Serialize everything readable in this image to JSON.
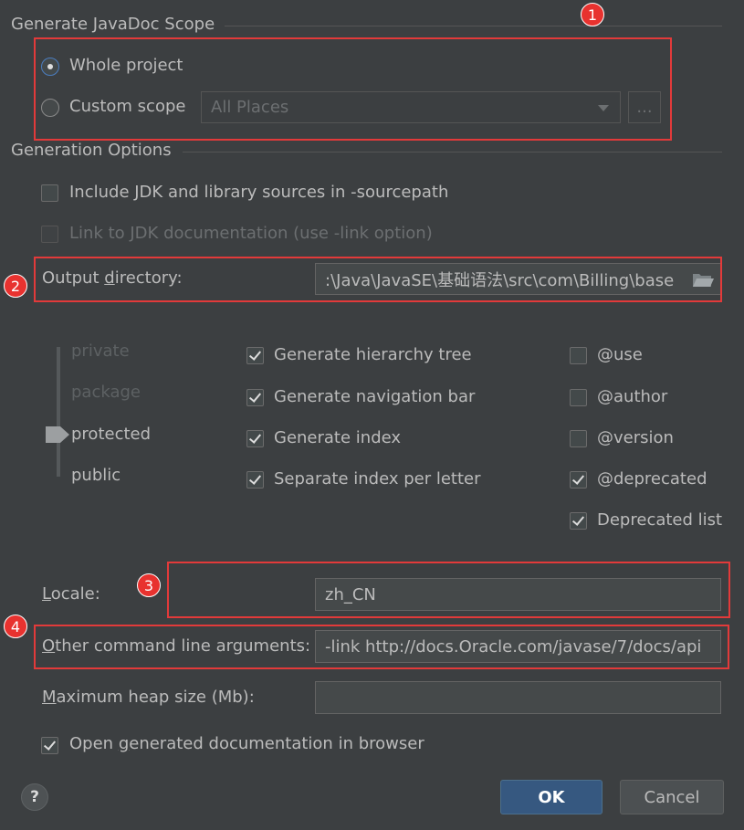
{
  "scope": {
    "section_title": "Generate JavaDoc Scope",
    "whole_project_label": "Whole project",
    "custom_scope_label": "Custom scope",
    "scope_dropdown_value": "All Places",
    "browse_button": "...",
    "selected": "whole_project"
  },
  "options": {
    "section_title": "Generation Options",
    "include_jdk_label": "Include JDK and library sources in -sourcepath",
    "include_jdk_checked": false,
    "link_jdk_label": "Link to JDK documentation (use -link option)",
    "link_jdk_checked": false,
    "output_dir_label": "Output directory:",
    "output_dir_value": ":\\Java\\JavaSE\\基础语法\\src\\com\\Billing\\base"
  },
  "visibility": {
    "levels": [
      "private",
      "package",
      "protected",
      "public"
    ],
    "selected": "protected"
  },
  "generate_checks": [
    {
      "label": "Generate hierarchy tree",
      "checked": true
    },
    {
      "label": "Generate navigation bar",
      "checked": true
    },
    {
      "label": "Generate index",
      "checked": true
    },
    {
      "label": "Separate index per letter",
      "checked": true
    }
  ],
  "tag_checks": [
    {
      "label": "@use",
      "checked": false
    },
    {
      "label": "@author",
      "checked": false
    },
    {
      "label": "@version",
      "checked": false
    },
    {
      "label": "@deprecated",
      "checked": true
    },
    {
      "label": "Deprecated list",
      "checked": true
    }
  ],
  "locale": {
    "label": "Locale:",
    "value": "zh_CN"
  },
  "other_args": {
    "label": "Other command line arguments:",
    "value": "-link http://docs.Oracle.com/javase/7/docs/api"
  },
  "heap": {
    "label": "Maximum heap size (Mb):",
    "value": ""
  },
  "open_browser": {
    "label": "Open generated documentation in browser",
    "checked": true
  },
  "buttons": {
    "help": "?",
    "ok": "OK",
    "cancel": "Cancel"
  },
  "annotations": [
    "1",
    "2",
    "3",
    "4"
  ],
  "colors": {
    "background": "#3c3f41",
    "annotation_red": "#e23a3a",
    "primary_button": "#365880"
  }
}
